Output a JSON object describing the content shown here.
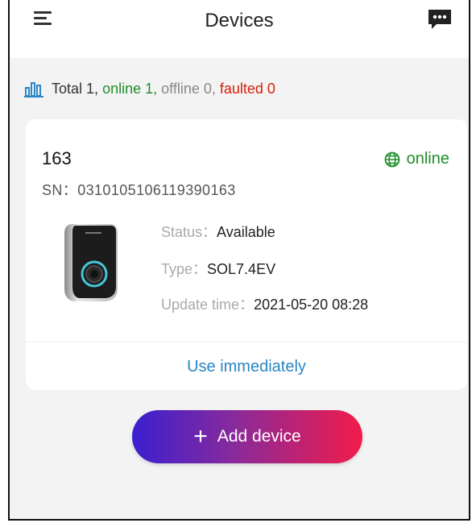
{
  "header": {
    "title": "Devices"
  },
  "summary": {
    "total": "Total 1,",
    "online": "online 1,",
    "offline": "offline 0,",
    "faulted": "faulted 0"
  },
  "device": {
    "name": "163",
    "status_badge": "online",
    "sn": "SN：0310105106119390163",
    "status_label": "Status：",
    "status_value": "Available",
    "type_label": "Type：",
    "type_value": "SOL7.4EV",
    "update_label": "Update time：",
    "update_value": "2021-05-20 08:28",
    "action": "Use immediately"
  },
  "add_button": {
    "plus": "+",
    "label": "Add device"
  },
  "colors": {
    "online": "#1f8f2a",
    "faulted": "#d81e06",
    "link": "#2a86c4",
    "gradient_start": "#3a1fd0",
    "gradient_end": "#f21b4a"
  },
  "icons": {
    "menu": "menu-icon",
    "message": "chat-bubble-icon",
    "stats": "bar-chart-icon",
    "online": "globe-icon",
    "device": "ev-charger-image"
  }
}
